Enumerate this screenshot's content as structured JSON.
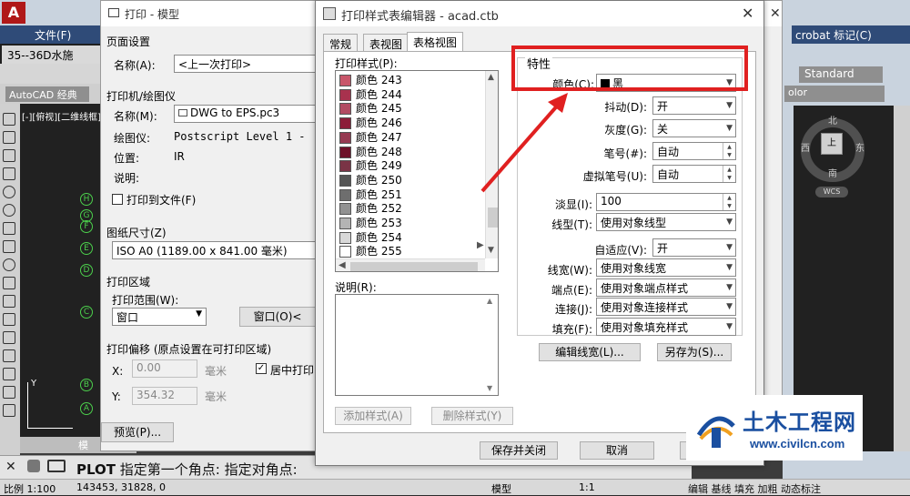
{
  "cad": {
    "file_menu": "文件(F)",
    "doc_tab": "35--36D水施",
    "workspace": "AutoCAD 经典",
    "view_label": "[-][俯视][二维线框]",
    "model_tab": "模",
    "acrobat": "crobat 标记(C)",
    "standard": "Standard",
    "color_combo": "olor",
    "compass": {
      "n": "北",
      "s": "南",
      "w": "西",
      "e": "东",
      "top": "上"
    },
    "wcs": "WCS",
    "command": {
      "cmd": "PLOT",
      "text": "指定第一个角点: 指定对角点:"
    },
    "status": {
      "scale": "比例 1:100",
      "coords": "143453, 31828, 0",
      "model": "模型",
      "annoscale": "1:1",
      "right": "编辑 基线 填充 加粗 动态标注"
    },
    "y_axis": "Y",
    "markers": [
      "H",
      "G",
      "F",
      "E",
      "D",
      "C",
      "B",
      "A"
    ]
  },
  "plot": {
    "title": "打印 - 模型",
    "page_setup": "页面设置",
    "name_label": "名称(A):",
    "name_value": "<上一次打印>",
    "printer_section": "打印机/绘图仪",
    "printer_name_label": "名称(M):",
    "printer_name_value": "DWG to EPS.pc3",
    "plotter_label": "绘图仪:",
    "plotter_value": "Postscript Level 1 -",
    "location_label": "位置:",
    "location_value": "IR",
    "desc_label": "说明:",
    "print_to_file": "打印到文件(F)",
    "paper_size_section": "图纸尺寸(Z)",
    "paper_size_value": "ISO A0 (1189.00 x 841.00 毫米)",
    "plot_area_section": "打印区域",
    "plot_range_label": "打印范围(W):",
    "plot_range_value": "窗口",
    "window_btn": "窗口(O)<",
    "offset_section": "打印偏移 (原点设置在可打印区域)",
    "x_label": "X:",
    "x_value": "0.00",
    "y_label": "Y:",
    "y_value": "354.32",
    "unit": "毫米",
    "center_plot": "居中打印(",
    "preview_btn": "预览(P)..."
  },
  "editor": {
    "title": "打印样式表编辑器 - acad.ctb",
    "tabs": [
      "常规",
      "表视图",
      "表格视图"
    ],
    "active_tab": 2,
    "styles_label": "打印样式(P):",
    "styles": [
      {
        "name": "颜色 243",
        "color": "#c8566a"
      },
      {
        "name": "颜色 244",
        "color": "#a8324e"
      },
      {
        "name": "颜色 245",
        "color": "#b24a62"
      },
      {
        "name": "颜色 246",
        "color": "#8c1c38"
      },
      {
        "name": "颜色 247",
        "color": "#963a52"
      },
      {
        "name": "颜色 248",
        "color": "#6e1028"
      },
      {
        "name": "颜色 249",
        "color": "#7a3446"
      },
      {
        "name": "颜色 250",
        "color": "#555555"
      },
      {
        "name": "颜色 251",
        "color": "#6e6e6e"
      },
      {
        "name": "颜色 252",
        "color": "#919191"
      },
      {
        "name": "颜色 253",
        "color": "#b4b4b4"
      },
      {
        "name": "颜色 254",
        "color": "#d8d8d8"
      },
      {
        "name": "颜色 255",
        "color": "#ffffff"
      }
    ],
    "desc_label": "说明(R):",
    "add_style": "添加样式(A)",
    "delete_style": "删除样式(Y)",
    "properties": {
      "title": "特性",
      "color_label": "颜色(C):",
      "color_value": "黑",
      "dither_label": "抖动(D):",
      "dither_value": "开",
      "grayscale_label": "灰度(G):",
      "grayscale_value": "关",
      "pen_label": "笔号(#):",
      "pen_value": "自动",
      "vpen_label": "虚拟笔号(U):",
      "vpen_value": "自动",
      "screening_label": "淡显(I):",
      "screening_value": "100",
      "linetype_label": "线型(T):",
      "linetype_value": "使用对象线型",
      "adaptive_label": "自适应(V):",
      "adaptive_value": "开",
      "lineweight_label": "线宽(W):",
      "lineweight_value": "使用对象线宽",
      "endstyle_label": "端点(E):",
      "endstyle_value": "使用对象端点样式",
      "joinstyle_label": "连接(J):",
      "joinstyle_value": "使用对象连接样式",
      "fill_label": "填充(F):",
      "fill_value": "使用对象填充样式"
    },
    "edit_lineweights": "编辑线宽(L)...",
    "save_as": "另存为(S)...",
    "save_close": "保存并关闭",
    "cancel": "取消"
  },
  "watermark": {
    "name": "土木工程网",
    "url": "www.civilcn.com"
  },
  "colors": {
    "highlight": "#e02020",
    "watermark_blue": "#1a4fa0"
  }
}
